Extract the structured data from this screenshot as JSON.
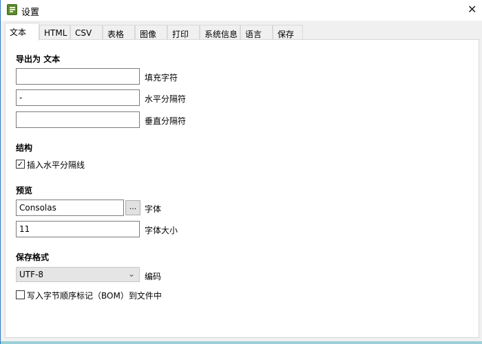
{
  "window": {
    "title": "设置",
    "close_icon": "close-icon"
  },
  "tabs": [
    "文本",
    "HTML",
    "CSV",
    "表格",
    "图像",
    "打印",
    "系统信息",
    "语言",
    "保存"
  ],
  "export": {
    "heading": "导出为 文本",
    "fill_char": {
      "value": "",
      "label": "填充字符"
    },
    "h_sep": {
      "value": "-",
      "label": "水平分隔符"
    },
    "v_sep": {
      "value": "",
      "label": "垂直分隔符"
    }
  },
  "structure": {
    "heading": "结构",
    "insert_hline": {
      "label": "插入水平分隔线",
      "checked": true
    }
  },
  "preview": {
    "heading": "预览",
    "font": {
      "value": "Consolas",
      "label": "字体",
      "browse": "..."
    },
    "font_size": {
      "value": "11",
      "label": "字体大小"
    }
  },
  "save_format": {
    "heading": "保存格式",
    "encoding": {
      "value": "UTF-8",
      "label": "编码"
    },
    "bom": {
      "label": "写入字节顺序标记（BOM）到文件中",
      "checked": false
    }
  }
}
